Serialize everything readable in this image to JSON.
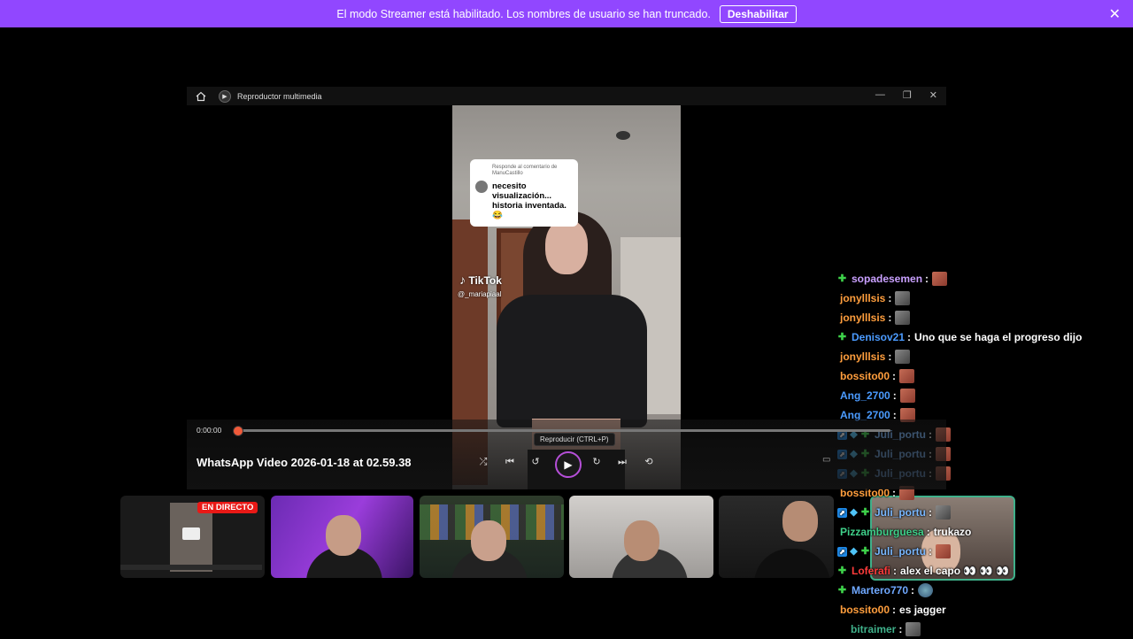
{
  "banner": {
    "message": "El modo Streamer está habilitado. Los nombres de usuario se han truncado.",
    "button": "Deshabilitar",
    "close": "✕"
  },
  "player": {
    "app_title": "Reproductor multimedia",
    "window_buttons": [
      "—",
      "❐",
      "✕"
    ],
    "time_elapsed": "0:00:00",
    "progress": 0.0,
    "video_title": "WhatsApp Video 2026-01-18 at 02.59.38",
    "tooltip": "Reproducir (CTRL+P)",
    "video": {
      "reply_header": "Responde al comentario de ManuCastillo",
      "reply_text": "necesito visualización... historia inventada.😂",
      "watermark": "TikTok",
      "watermark_user": "@_mariapiaal"
    }
  },
  "cams": {
    "live_badge": "EN DIRECTO"
  },
  "chat": {
    "messages": [
      {
        "badges": [
          "plus"
        ],
        "user": "sopadesemen",
        "color": "#c9a0ff",
        "sep": ":",
        "text": "",
        "emote": "em-red"
      },
      {
        "badges": [],
        "user": "jonylllsis",
        "color": "#ff9e3d",
        "sep": ":",
        "text": "",
        "emote": "em-gray"
      },
      {
        "badges": [],
        "user": "jonylllsis",
        "color": "#ff9e3d",
        "sep": ":",
        "text": "",
        "emote": "em-gray"
      },
      {
        "badges": [
          "plus"
        ],
        "user": "Denisov21",
        "color": "#4b9bff",
        "sep": ":",
        "text": "Uno que se haga el progreso dijo",
        "emote": ""
      },
      {
        "badges": [],
        "user": "jonylllsis",
        "color": "#ff9e3d",
        "sep": ":",
        "text": "",
        "emote": "em-gray"
      },
      {
        "badges": [],
        "user": "bossito00",
        "color": "#ff9e3d",
        "sep": ":",
        "text": "",
        "emote": "em-red"
      },
      {
        "badges": [],
        "user": "Ang_2700",
        "color": "#4b9bff",
        "sep": ":",
        "text": "",
        "emote": "em-red"
      },
      {
        "badges": [],
        "user": "Ang_2700",
        "color": "#4b9bff",
        "sep": ":",
        "text": "",
        "emote": "em-red"
      },
      {
        "badges": [
          "blue",
          "cyan",
          "plus"
        ],
        "user": "Juli_portu",
        "color": "#7ab8ff",
        "sep": ":",
        "text": "",
        "emote": "em-red"
      },
      {
        "badges": [
          "blue",
          "cyan",
          "plus"
        ],
        "user": "Juli_portu",
        "color": "#7ab8ff",
        "sep": ":",
        "text": "",
        "emote": "em-red"
      },
      {
        "badges": [
          "blue",
          "cyan",
          "plus"
        ],
        "user": "Juli_portu",
        "color": "#7ab8ff",
        "sep": ":",
        "text": "",
        "emote": "em-red"
      },
      {
        "badges": [],
        "user": "bossito00",
        "color": "#ff9e3d",
        "sep": ":",
        "text": "",
        "emote": "em-red"
      },
      {
        "badges": [
          "blue",
          "cyan",
          "plus"
        ],
        "user": "Juli_portu",
        "color": "#7ab8ff",
        "sep": ":",
        "text": "",
        "emote": "em-gray"
      },
      {
        "badges": [],
        "user": "Pizzamburguesa",
        "color": "#3fd08a",
        "sep": ":",
        "text": "trukazo",
        "emote": ""
      },
      {
        "badges": [
          "blue",
          "cyan",
          "plus"
        ],
        "user": "Juli_portu",
        "color": "#7ab8ff",
        "sep": ":",
        "text": "",
        "emote": "em-red"
      },
      {
        "badges": [
          "plus"
        ],
        "user": "Loferafi",
        "color": "#ff3b3b",
        "sep": ":",
        "text": "alex el capo 👀 👀 👀",
        "emote": ""
      },
      {
        "badges": [
          "plus"
        ],
        "user": "Martero770",
        "color": "#6fa8ff",
        "sep": ":",
        "text": "",
        "emote": "em-blue"
      },
      {
        "badges": [],
        "user": "bossito00",
        "color": "#ff9e3d",
        "sep": ":",
        "text": "es jagger",
        "emote": ""
      },
      {
        "badges": [
          "indent"
        ],
        "user": "bitraimer",
        "color": "#3fb08a",
        "sep": ":",
        "text": "",
        "emote": "em-gray"
      }
    ]
  }
}
